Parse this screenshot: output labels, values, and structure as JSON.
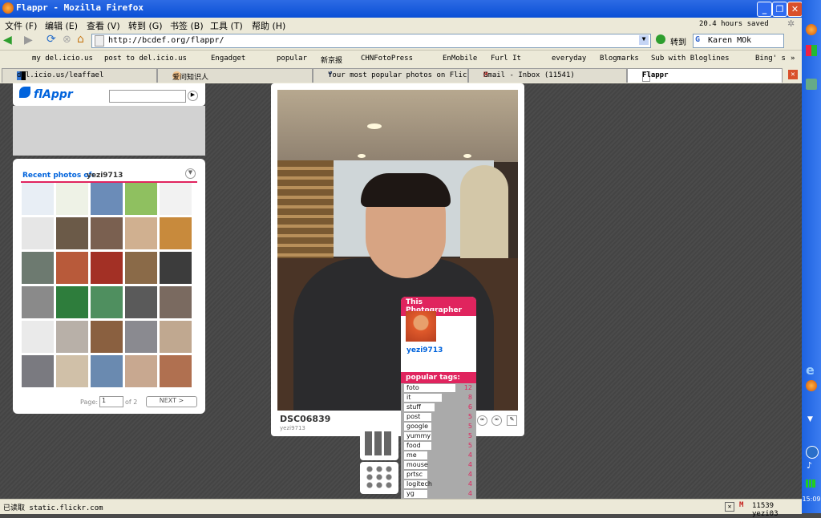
{
  "window": {
    "title": "Flappr - Mozilla Firefox"
  },
  "menu": [
    "文件 (F)",
    "编辑 (E)",
    "查看 (V)",
    "转到 (G)",
    "书签 (B)",
    "工具 (T)",
    "帮助 (H)"
  ],
  "menu_status": "20.4 hours saved",
  "nav": {
    "url": "http://bcdef.org/flappr/",
    "go_label": "转到",
    "search_value": "Karen MOk"
  },
  "bookmarks": [
    "my del.icio.us",
    "post to del.icio.us",
    "Engadget",
    "popular",
    "新京报",
    "CHNFotoPress",
    "EnMobile",
    "Furl It",
    "everyday",
    "Blogmarks",
    "Sub with Bloglines",
    "Bing' s"
  ],
  "tabs": [
    "del.icio.us/leaffael",
    "爱问知识人",
    "Your most popular photos on Flick...",
    "Gmail - Inbox (11541)",
    "Flappr"
  ],
  "status": {
    "left": "已读取 static.flickr.com",
    "right": "11539 yezi03"
  },
  "clock": "15:09",
  "flappr": {
    "logo": "flAppr",
    "recent_label": "Recent photos of:",
    "user": "yezi9713",
    "page_label": "Page:",
    "page_value": "1",
    "page_of": "of 2",
    "next_label": "NEXT >"
  },
  "photo": {
    "title": "DSC06839",
    "owner": "yezi9713"
  },
  "this_photographer": {
    "label": "This Photographer",
    "user": "yezi9713"
  },
  "tags_label": "popular tags:",
  "tags": [
    {
      "name": "foto",
      "count": "12"
    },
    {
      "name": "it",
      "count": "8"
    },
    {
      "name": "stuff",
      "count": "6"
    },
    {
      "name": "post",
      "count": "5"
    },
    {
      "name": "google",
      "count": "5"
    },
    {
      "name": "yummy",
      "count": "5"
    },
    {
      "name": "food",
      "count": "5"
    },
    {
      "name": "me",
      "count": "4"
    },
    {
      "name": "mouse",
      "count": "4"
    },
    {
      "name": "prtsc",
      "count": "4"
    },
    {
      "name": "logitech",
      "count": "4"
    },
    {
      "name": "yg",
      "count": "4"
    }
  ],
  "colors": {
    "accent": "#e0245e",
    "link": "#0063dc",
    "titlebar": "#0a4fd6"
  }
}
